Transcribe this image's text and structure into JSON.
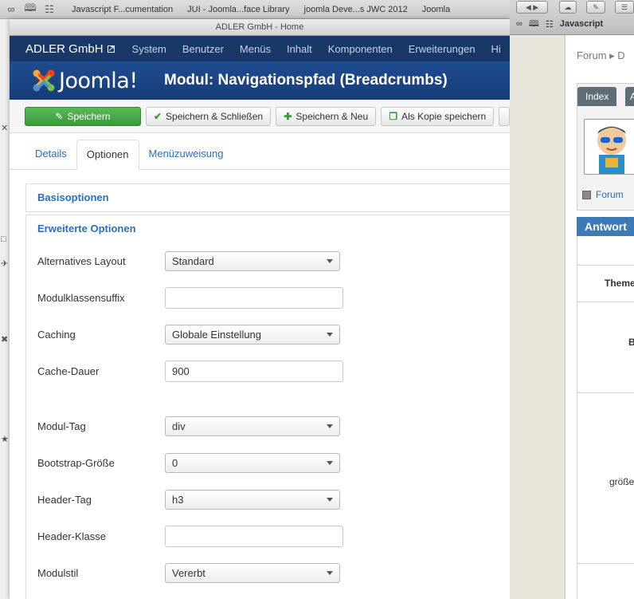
{
  "bookmarks": [
    "Javascript F...cumentation",
    "JUI - Joomla...face Library",
    "joomla Deve...s JWC 2012",
    "Joomla"
  ],
  "window_title": "ADLER GmbH - Home",
  "topnav": {
    "brand": "ADLER GmbH",
    "items": [
      "System",
      "Benutzer",
      "Menüs",
      "Inhalt",
      "Komponenten",
      "Erweiterungen",
      "Hi"
    ]
  },
  "logo_text": "Joomla!",
  "page_title": "Modul: Navigationspfad (Breadcrumbs)",
  "toolbar": {
    "save": "Speichern",
    "save_close": "Speichern & Schließen",
    "save_new": "Speichern & Neu",
    "save_copy": "Als Kopie speichern"
  },
  "tabs": [
    "Details",
    "Optionen",
    "Menüzuweisung"
  ],
  "accordion": {
    "basic": "Basisoptionen",
    "advanced": "Erweiterte Optionen"
  },
  "fields": {
    "layout": {
      "label": "Alternatives Layout",
      "value": "Standard"
    },
    "suffix": {
      "label": "Modulklassensuffix",
      "value": ""
    },
    "caching": {
      "label": "Caching",
      "value": "Globale Einstellung"
    },
    "cache_time": {
      "label": "Cache-Dauer",
      "value": "900"
    },
    "module_tag": {
      "label": "Modul-Tag",
      "value": "div"
    },
    "bootstrap_size": {
      "label": "Bootstrap-Größe",
      "value": "0"
    },
    "header_tag": {
      "label": "Header-Tag",
      "value": "h3"
    },
    "header_class": {
      "label": "Header-Klasse",
      "value": ""
    },
    "module_style": {
      "label": "Modulstil",
      "value": "Vererbt"
    }
  },
  "right_window": {
    "tab_text": "Javascript",
    "breadcrumb": "Forum ▸ D",
    "tab_index": "Index",
    "tab_a": "A",
    "forum_link": "Forum",
    "answer_bar": "Antwort",
    "cells": [
      "Theme",
      "B",
      "größe"
    ]
  },
  "colors": {
    "topnav": "#1a3867",
    "header": "#1f4d92",
    "save_button": "#46a546",
    "link": "#2a6ebc"
  }
}
